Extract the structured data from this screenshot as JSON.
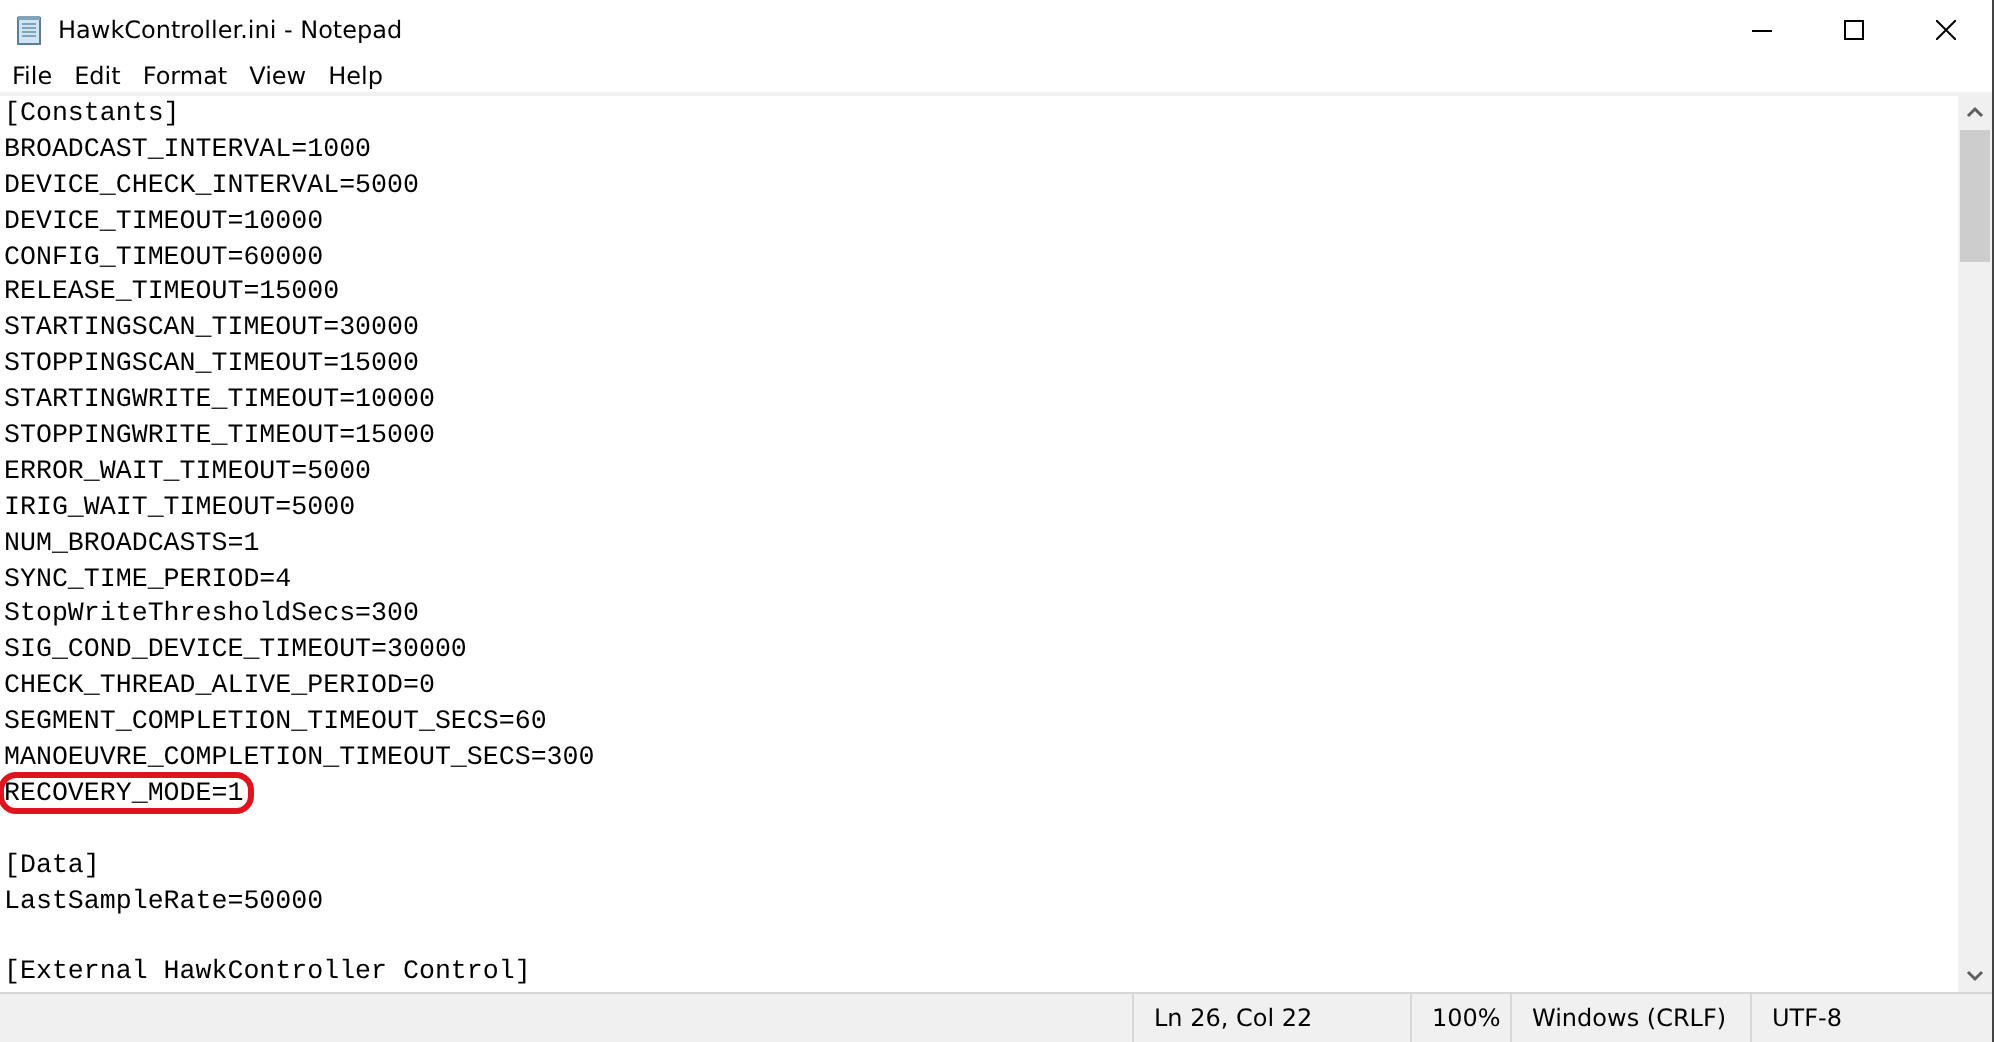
{
  "window": {
    "title": "HawkController.ini - Notepad"
  },
  "menu": [
    "File",
    "Edit",
    "Format",
    "View",
    "Help"
  ],
  "sections": [
    {
      "header": "[Constants]",
      "lines": [
        {
          "text": "BROADCAST_INTERVAL=1000",
          "highlighted": false
        },
        {
          "text": "DEVICE_CHECK_INTERVAL=5000",
          "highlighted": false
        },
        {
          "text": "DEVICE_TIMEOUT=10000",
          "highlighted": false
        },
        {
          "text": "CONFIG_TIMEOUT=60000",
          "highlighted": false
        },
        {
          "text": "RELEASE_TIMEOUT=15000",
          "highlighted": false
        },
        {
          "text": "STARTINGSCAN_TIMEOUT=30000",
          "highlighted": false
        },
        {
          "text": "STOPPINGSCAN_TIMEOUT=15000",
          "highlighted": false
        },
        {
          "text": "STARTINGWRITE_TIMEOUT=10000",
          "highlighted": false
        },
        {
          "text": "STOPPINGWRITE_TIMEOUT=15000",
          "highlighted": false
        },
        {
          "text": "ERROR_WAIT_TIMEOUT=5000",
          "highlighted": false
        },
        {
          "text": "IRIG_WAIT_TIMEOUT=5000",
          "highlighted": false
        },
        {
          "text": "NUM_BROADCASTS=1",
          "highlighted": false
        },
        {
          "text": "SYNC_TIME_PERIOD=4",
          "highlighted": false
        },
        {
          "text": "StopWriteThresholdSecs=300",
          "highlighted": false
        },
        {
          "text": "SIG_COND_DEVICE_TIMEOUT=30000",
          "highlighted": false
        },
        {
          "text": "CHECK_THREAD_ALIVE_PERIOD=0",
          "highlighted": false
        },
        {
          "text": "SEGMENT_COMPLETION_TIMEOUT_SECS=60",
          "highlighted": false
        },
        {
          "text": "MANOEUVRE_COMPLETION_TIMEOUT_SECS=300",
          "highlighted": false
        },
        {
          "text": "RECOVERY_MODE=1",
          "highlighted": true
        }
      ]
    },
    {
      "header": "[Data]",
      "lines": [
        {
          "text": "LastSampleRate=50000",
          "highlighted": false
        }
      ]
    },
    {
      "header": "[External HawkController Control]"
    }
  ],
  "status_bar": {
    "position": "Ln 26, Col 22",
    "zoom": "100%",
    "line_ending": "Windows (CRLF)",
    "encoding": "UTF-8"
  }
}
